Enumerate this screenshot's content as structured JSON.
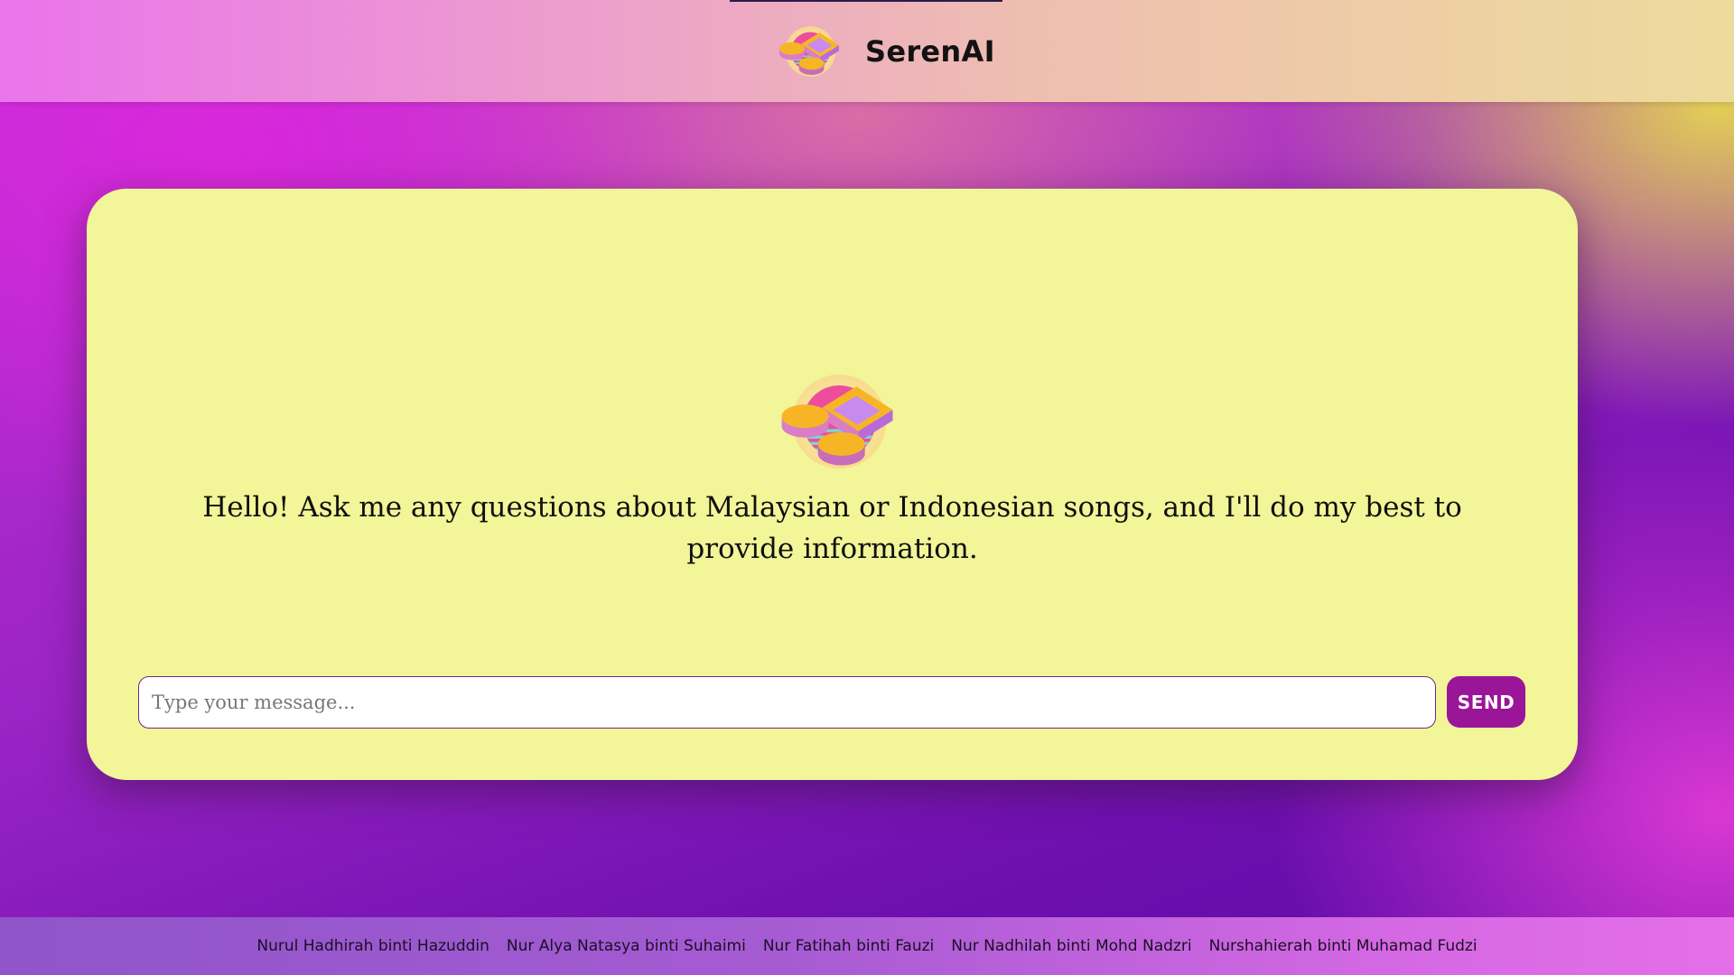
{
  "header": {
    "app_name": "SerenAI",
    "logo_icon": "music-note-logo-icon"
  },
  "chat": {
    "greeting": "Hello! Ask me any questions about Malaysian or Indonesian songs, and I'll do my best to provide information.",
    "hero_icon": "music-note-logo-icon",
    "input_placeholder": "Type your message...",
    "input_value": "",
    "send_label": "SEND"
  },
  "footer": {
    "members": [
      "Nurul Hadhirah binti Hazuddin",
      "Nur Alya Natasya binti Suhaimi",
      "Nur Fatihah binti Fauzi",
      "Nur Nadhilah binti Mohd Nadzri",
      "Nurshahierah binti Muhamad Fudzi"
    ]
  },
  "colors": {
    "card_background": "#f2f598",
    "send_button": "#9b1598",
    "header_gradient_start": "#ea74ec",
    "header_gradient_end": "#eddb9c",
    "page_gradient_dark": "#5a0aa8"
  }
}
